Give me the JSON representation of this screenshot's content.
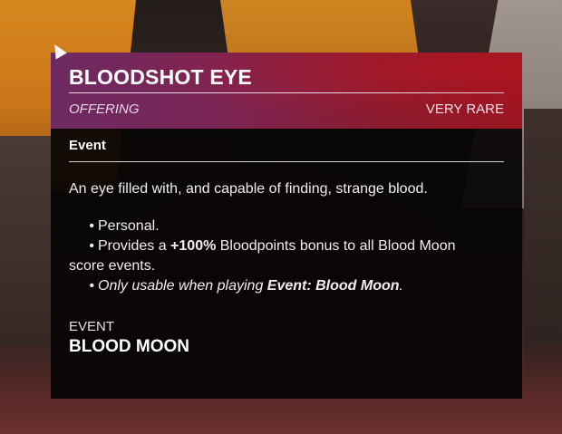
{
  "tooltip": {
    "title": "BLOODSHOT EYE",
    "item_type": "OFFERING",
    "rarity": "VERY RARE",
    "section_heading": "Event",
    "description": "An eye filled with, and capable of finding, strange blood.",
    "bullets": {
      "b1": "Personal.",
      "b2_prefix": "Provides a ",
      "b2_bold": "+100%",
      "b2_suffix": " Bloodpoints bonus to all Blood Moon",
      "b2_continued": "score events.",
      "b3_prefix": "Only usable when playing ",
      "b3_bold": "Event: Blood Moon",
      "b3_suffix": "."
    },
    "event_label": "EVENT",
    "event_name": "BLOOD MOON"
  },
  "colors": {
    "header_purple": "#6d2a62",
    "header_red": "#9a1520",
    "card_bg": "#060404"
  },
  "icons": {
    "cursor": "mouse-cursor-icon"
  }
}
